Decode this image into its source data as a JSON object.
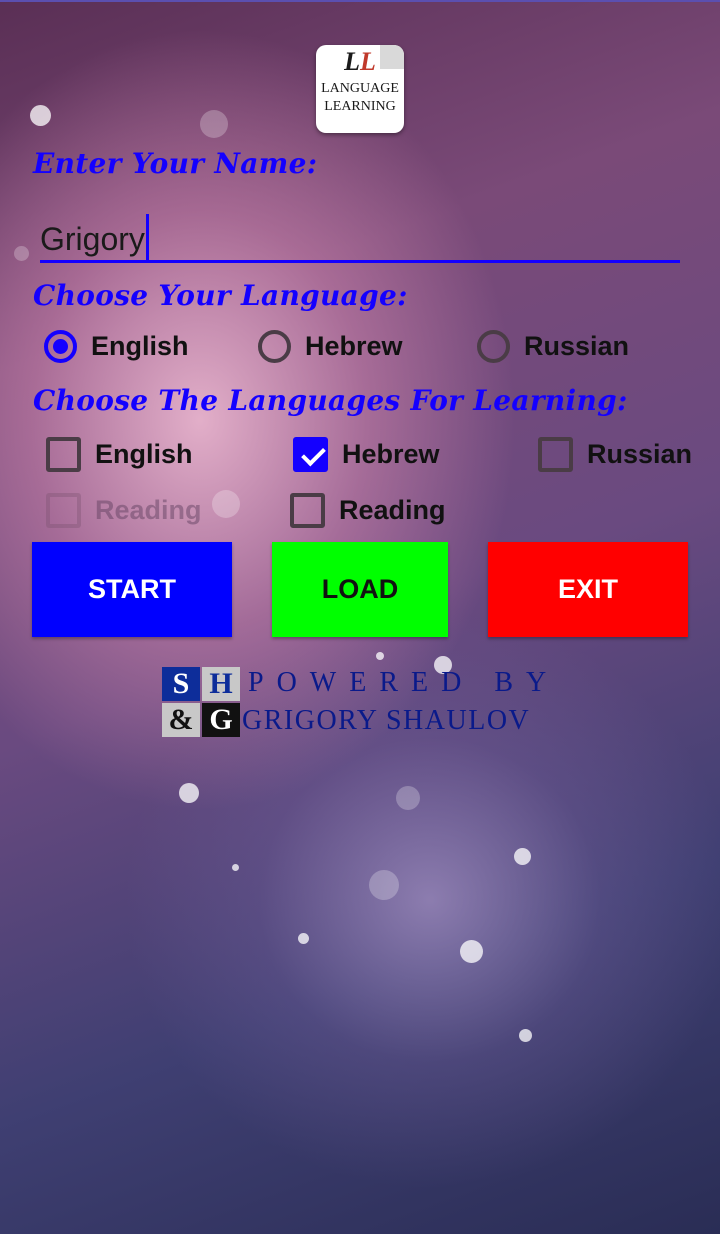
{
  "logo": {
    "line1": "LANGUAGE",
    "line2": "LEARNING",
    "mono_left": "L",
    "mono_right": "L"
  },
  "name_section": {
    "heading": "Enter Your Name:",
    "value": "Grigory"
  },
  "language_section": {
    "heading": "Choose Your Language:",
    "options": [
      {
        "label": "English",
        "selected": true
      },
      {
        "label": "Hebrew",
        "selected": false
      },
      {
        "label": "Russian",
        "selected": false
      }
    ]
  },
  "learning_section": {
    "heading": "Choose The Languages For Learning:",
    "languages": [
      {
        "label": "English",
        "checked": false
      },
      {
        "label": "Hebrew",
        "checked": true
      },
      {
        "label": "Russian",
        "checked": false
      }
    ],
    "reading": [
      {
        "label": "Reading",
        "checked": false,
        "enabled": false
      },
      {
        "label": "Reading",
        "checked": false,
        "enabled": true
      }
    ]
  },
  "buttons": {
    "start": "START",
    "load": "LOAD",
    "exit": "EXIT"
  },
  "colors": {
    "accent": "#1400ff",
    "start_bg": "#0000ff",
    "load_bg": "#00ff00",
    "exit_bg": "#ff0000"
  },
  "footer": {
    "badge": {
      "s": "S",
      "h": "H",
      "amp": "&",
      "g": "G"
    },
    "line1": "POWERED BY",
    "line2": "GRIGORY SHAULOV"
  }
}
